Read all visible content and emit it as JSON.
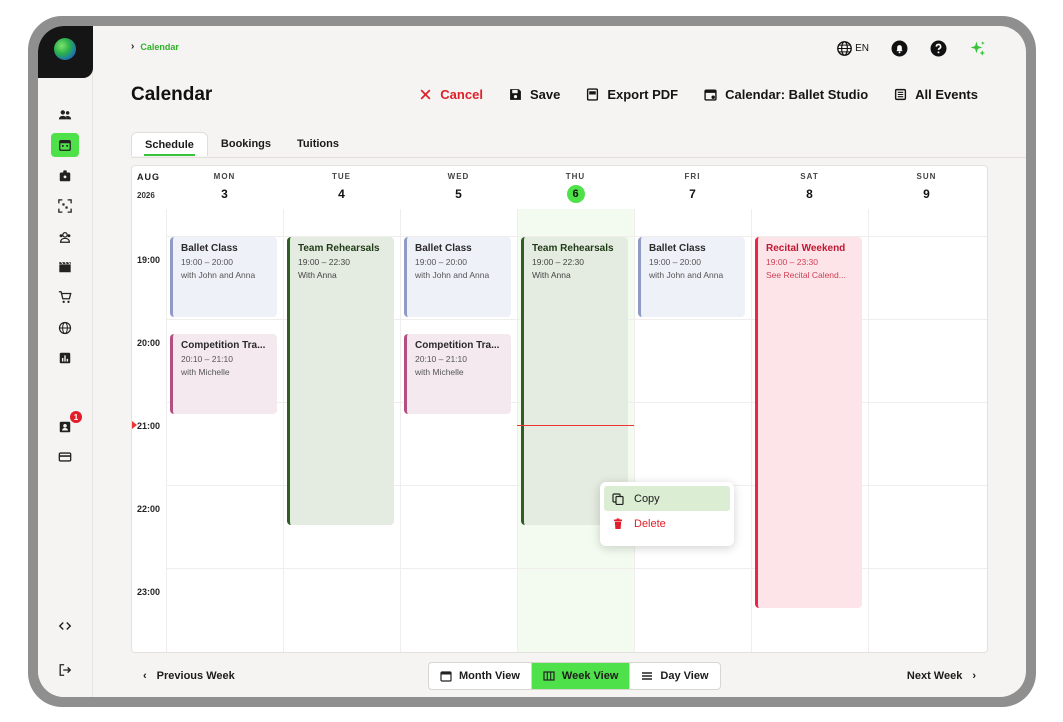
{
  "breadcrumb": {
    "label": "Calendar"
  },
  "header": {
    "language": "EN"
  },
  "page": {
    "title": "Calendar"
  },
  "actions": {
    "cancel": "Cancel",
    "save": "Save",
    "export": "Export PDF",
    "calendar": "Calendar: Ballet Studio",
    "all_events": "All Events"
  },
  "tabs": [
    "Schedule",
    "Bookings",
    "Tuitions"
  ],
  "calendar": {
    "month": "AUG",
    "year": "2026",
    "days": [
      {
        "name": "MON",
        "num": "3"
      },
      {
        "name": "TUE",
        "num": "4"
      },
      {
        "name": "WED",
        "num": "5"
      },
      {
        "name": "THU",
        "num": "6"
      },
      {
        "name": "FRI",
        "num": "7"
      },
      {
        "name": "SAT",
        "num": "8"
      },
      {
        "name": "SUN",
        "num": "9"
      }
    ],
    "times": [
      "19:00",
      "20:00",
      "21:00",
      "22:00",
      "23:00"
    ],
    "events": [
      {
        "title": "Ballet Class",
        "time": "19:00 – 20:00",
        "who": "with John and Anna"
      },
      {
        "title": "Competition Tra...",
        "time": "20:10 – 21:10",
        "who": "with Michelle"
      },
      {
        "title": "Team Rehearsals",
        "time": "19:00 – 22:30",
        "who": "With Anna"
      },
      {
        "title": "Ballet Class",
        "time": "19:00 – 20:00",
        "who": "with John and Anna"
      },
      {
        "title": "Competition Tra...",
        "time": "20:10 – 21:10",
        "who": "with Michelle"
      },
      {
        "title": "Team Rehearsals",
        "time": "19:00 – 22:30",
        "who": "With Anna"
      },
      {
        "title": "Ballet Class",
        "time": "19:00 – 20:00",
        "who": "with John and Anna"
      },
      {
        "title": "Recital Weekend",
        "time": "19:00 – 23:30",
        "who": "See Recital Calend..."
      }
    ]
  },
  "context_menu": {
    "copy": "Copy",
    "delete": "Delete"
  },
  "footer": {
    "prev": "Previous Week",
    "next": "Next Week",
    "views": [
      "Month View",
      "Week View",
      "Day View"
    ]
  },
  "sidebar": {
    "notification_count": "1"
  },
  "colors": {
    "accent": "#4fe14a",
    "danger": "#e0202a"
  }
}
